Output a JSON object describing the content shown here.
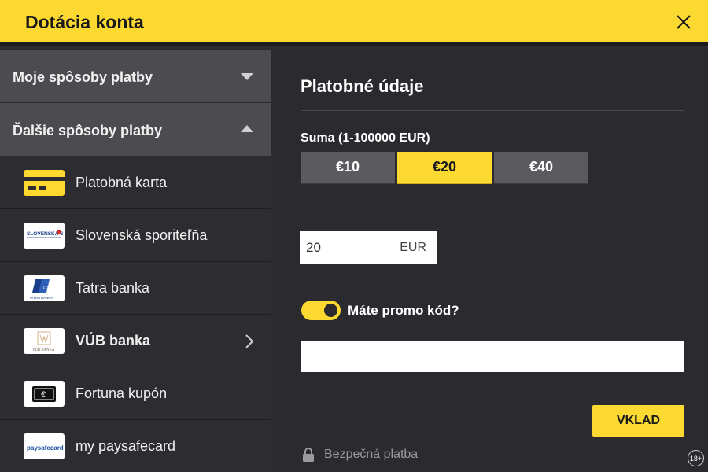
{
  "header": {
    "title": "Dotácia konta"
  },
  "sidebar": {
    "my_methods_label": "Moje spôsoby platby",
    "other_methods_label": "Ďalšie spôsoby platby",
    "methods": [
      {
        "label": "Platobná karta",
        "icon": "card-icon"
      },
      {
        "label": "Slovenská sporiteľňa",
        "icon": "slsp-logo",
        "logo_text": "SLOVENSKÁ SPORITEĽŇA"
      },
      {
        "label": "Tatra banka",
        "icon": "tatra-banka-logo",
        "logo_text": "TATRA BANKA"
      },
      {
        "label": "VÚB banka",
        "icon": "vub-logo",
        "logo_text": "VÚB BANKA"
      },
      {
        "label": "Fortuna kupón",
        "icon": "euro-voucher-icon"
      },
      {
        "label": "my paysafecard",
        "icon": "paysafecard-logo",
        "logo_text": "paysafecard"
      }
    ]
  },
  "payment": {
    "title": "Platobné údaje",
    "amount_label": "Suma (1-100000 EUR)",
    "amounts": [
      "€10",
      "€20",
      "€40"
    ],
    "selected_amount": "€20",
    "amount_value": "20",
    "currency": "EUR",
    "promo_label": "Máte promo kód?",
    "promo_enabled": true,
    "promo_value": "",
    "submit_label": "VKLAD",
    "secure_label": "Bezpečná platba",
    "age_badge": "18+"
  },
  "colors": {
    "accent": "#fcd930",
    "panel": "#2b2b2f",
    "section": "#4c4c50"
  }
}
